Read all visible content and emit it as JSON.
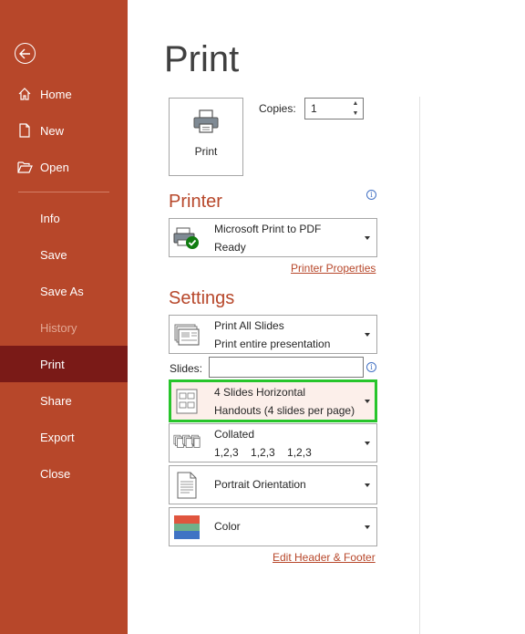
{
  "sidebar": {
    "back_icon": "back-arrow-icon",
    "items": [
      {
        "label": "Home",
        "icon": "home-icon"
      },
      {
        "label": "New",
        "icon": "new-document-icon"
      },
      {
        "label": "Open",
        "icon": "open-folder-icon"
      },
      {
        "label": "Info"
      },
      {
        "label": "Save"
      },
      {
        "label": "Save As"
      },
      {
        "label": "History"
      },
      {
        "label": "Print"
      },
      {
        "label": "Share"
      },
      {
        "label": "Export"
      },
      {
        "label": "Close"
      }
    ],
    "active": "Print",
    "disabled": "History"
  },
  "main": {
    "title": "Print",
    "print_button_label": "Print",
    "copies_label": "Copies:",
    "copies_value": "1",
    "printer_heading": "Printer",
    "printer": {
      "name": "Microsoft Print to PDF",
      "status": "Ready"
    },
    "printer_properties_link": "Printer Properties",
    "settings_heading": "Settings",
    "slides_dropdown": {
      "line1": "Print All Slides",
      "line2": "Print entire presentation"
    },
    "slides_label": "Slides:",
    "slides_value": "",
    "layout_dropdown": {
      "line1": "4 Slides Horizontal",
      "line2": "Handouts (4 slides per page)"
    },
    "collation_dropdown": {
      "line1": "Collated",
      "line2": "1,2,3    1,2,3    1,2,3"
    },
    "orientation_dropdown": {
      "line1": "Portrait Orientation"
    },
    "color_dropdown": {
      "line1": "Color"
    },
    "edit_header_footer_link": "Edit Header & Footer"
  },
  "colors": {
    "accent": "#b7472a",
    "sidebar_active": "#7a1a17",
    "highlight_border": "#27c52b"
  }
}
